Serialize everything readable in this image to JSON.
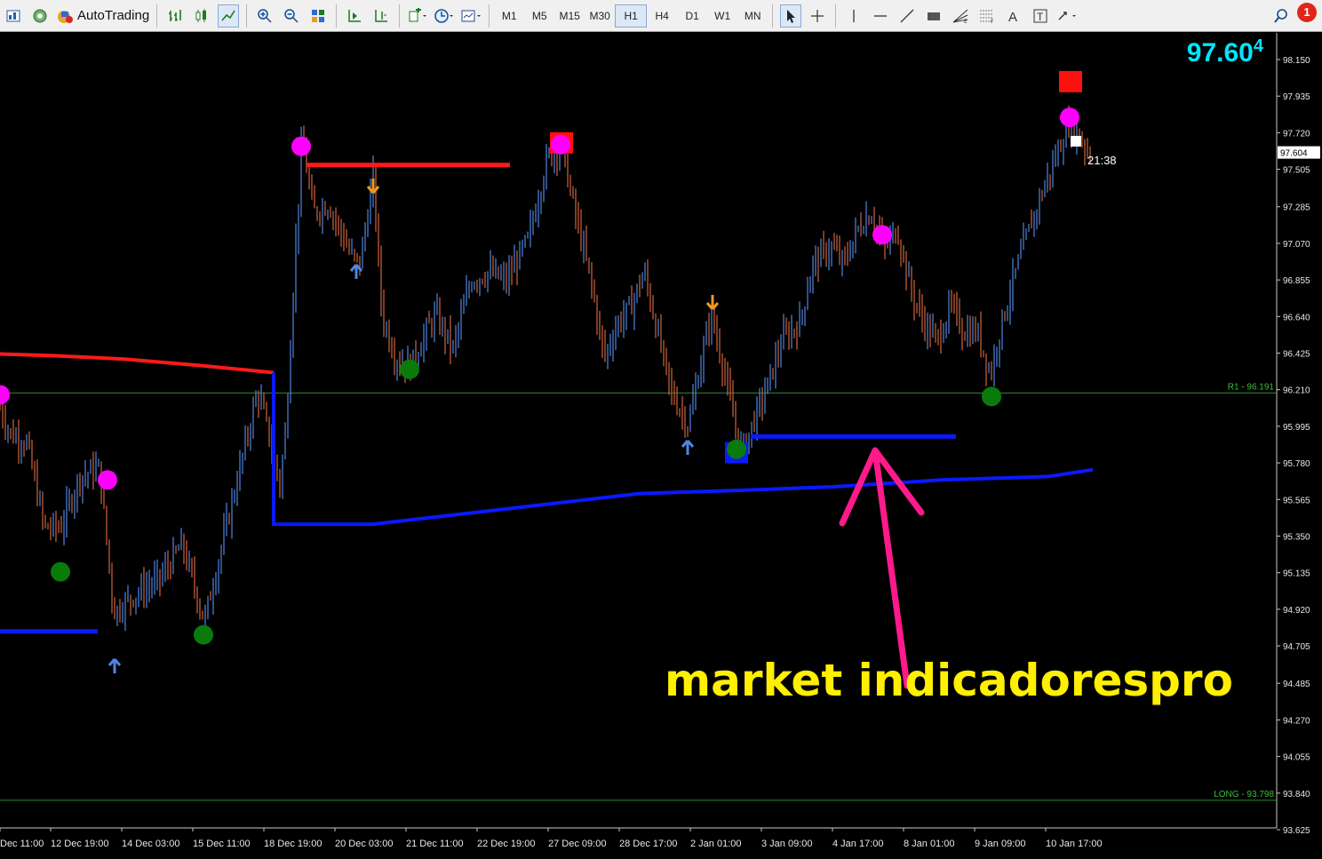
{
  "toolbar": {
    "auto_trading_label": "AutoTrading",
    "timeframes": [
      "M1",
      "M5",
      "M15",
      "M30",
      "H1",
      "H4",
      "D1",
      "W1",
      "MN"
    ],
    "active_timeframe": "H1",
    "notification_count": "1"
  },
  "chart": {
    "current_price_main": "97.60",
    "current_price_pip": "4",
    "current_price_tag": "97.604",
    "candle_timer": "21:38",
    "watermark": "market indicadorespro",
    "y_ticks": [
      "98.150",
      "97.935",
      "97.720",
      "97.505",
      "97.285",
      "97.070",
      "96.855",
      "96.640",
      "96.425",
      "96.210",
      "95.995",
      "95.780",
      "95.565",
      "95.350",
      "95.135",
      "94.920",
      "94.705",
      "94.485",
      "94.270",
      "94.055",
      "93.840",
      "93.625"
    ],
    "x_ticks": [
      "Dec 11:00",
      "12 Dec 19:00",
      "14 Dec 03:00",
      "15 Dec 11:00",
      "18 Dec 19:00",
      "20 Dec 03:00",
      "21 Dec 11:00",
      "22 Dec 19:00",
      "27 Dec 09:00",
      "28 Dec 17:00",
      "2 Jan 01:00",
      "3 Jan 09:00",
      "4 Jan 17:00",
      "8 Jan 01:00",
      "9 Jan 09:00",
      "10 Jan 17:00"
    ],
    "hlines": [
      {
        "label": "R1 - 96.191",
        "price": 96.191,
        "color": "#2e8b2e"
      },
      {
        "label": "LONG - 93.798",
        "price": 93.798,
        "color": "#2e8b2e"
      }
    ],
    "colors": {
      "bull": "#4f86e0",
      "bear": "#d0643c",
      "resistance": "#ff1a1a",
      "support": "#0a1aff",
      "top_marker": "#ff00ff",
      "bottom_marker": "#0a7a0a",
      "arrow_pink": "#ff1a8c"
    }
  }
}
